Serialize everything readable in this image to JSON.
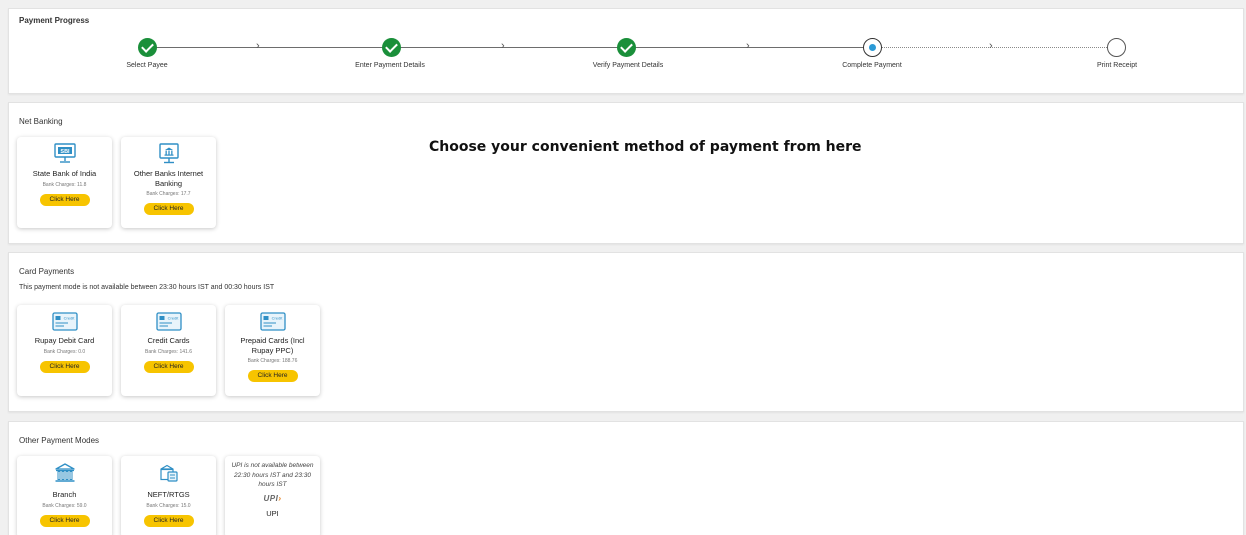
{
  "progress": {
    "title": "Payment Progress",
    "steps": [
      {
        "label": "Select Payee",
        "state": "done"
      },
      {
        "label": "Enter Payment Details",
        "state": "done"
      },
      {
        "label": "Verify Payment Details",
        "state": "done"
      },
      {
        "label": "Complete Payment",
        "state": "current"
      },
      {
        "label": "Print Receipt",
        "state": "todo"
      }
    ],
    "chevron": "›"
  },
  "net_banking": {
    "title": "Net Banking",
    "message": "Choose your convenient method of payment from here",
    "cards": [
      {
        "name": "State Bank of India",
        "charges": "Bank Charges: 11.8",
        "button": "Click Here",
        "icon": "sbi-bank-icon"
      },
      {
        "name": "Other Banks Internet Banking",
        "charges": "Bank Charges: 17.7",
        "button": "Click Here",
        "icon": "bank-monitor-icon"
      }
    ]
  },
  "card_payments": {
    "title": "Card Payments",
    "note": "This payment mode is not available between 23:30 hours IST and 00:30 hours IST",
    "cards": [
      {
        "name": "Rupay Debit Card",
        "charges": "Bank Charges: 0.0",
        "button": "Click Here",
        "icon": "credit-card-icon",
        "icon_text": "Credit"
      },
      {
        "name": "Credit Cards",
        "charges": "Bank Charges: 141.6",
        "button": "Click Here",
        "icon": "credit-card-icon",
        "icon_text": "Credit"
      },
      {
        "name": "Prepaid Cards (Incl Rupay PPC)",
        "charges": "Bank Charges: 188.76",
        "button": "Click Here",
        "icon": "credit-card-icon",
        "icon_text": "Credit"
      }
    ]
  },
  "other_modes": {
    "title": "Other Payment Modes",
    "cards": [
      {
        "name": "Branch",
        "charges": "Bank Charges: 59.0",
        "button": "Click Here",
        "icon": "bank-building-icon"
      },
      {
        "name": "NEFT/RTGS",
        "charges": "Bank Charges: 15.0",
        "button": "Click Here",
        "icon": "neft-transfer-icon"
      }
    ],
    "upi": {
      "note": "UPI is not available between 22:30 hours IST and 23:30 hours IST",
      "logo_main": "UPI",
      "logo_accent": "›",
      "label": "UPI"
    }
  },
  "colors": {
    "done": "#1a8f3a",
    "current_dot": "#2b9ad6",
    "button": "#f7c400",
    "icon_blue": "#2f8fc5"
  }
}
